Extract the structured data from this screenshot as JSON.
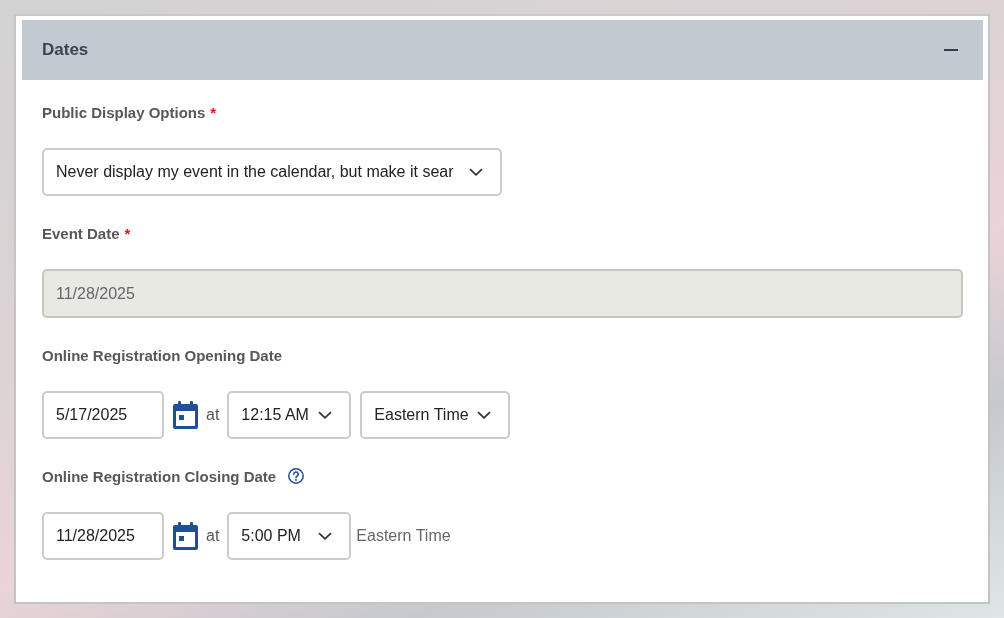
{
  "section": {
    "title": "Dates",
    "expanded": true,
    "fields": [
      {
        "kind": "select",
        "label": "Public Display Options",
        "required_mark": "*",
        "help": false,
        "disabled": false,
        "value": "Never display my event in the calendar, but make it sear"
      },
      {
        "kind": "date",
        "label": "Event Date",
        "required_mark": "*",
        "help": false,
        "disabled": true,
        "value": "11/28/2025"
      },
      {
        "kind": "datetime",
        "label": "Online Registration Opening Date",
        "help": false,
        "disabled": false,
        "date": "5/17/2025",
        "connector": "at",
        "time": "12:15 AM",
        "timezone": {
          "kind": "select",
          "value": "Eastern Time"
        }
      },
      {
        "kind": "datetime",
        "label": "Online Registration Closing Date",
        "help": true,
        "disabled": false,
        "date": "11/28/2025",
        "connector": "at",
        "time": "5:00 PM",
        "timezone": {
          "kind": "text",
          "value": "Eastern Time"
        }
      }
    ]
  }
}
